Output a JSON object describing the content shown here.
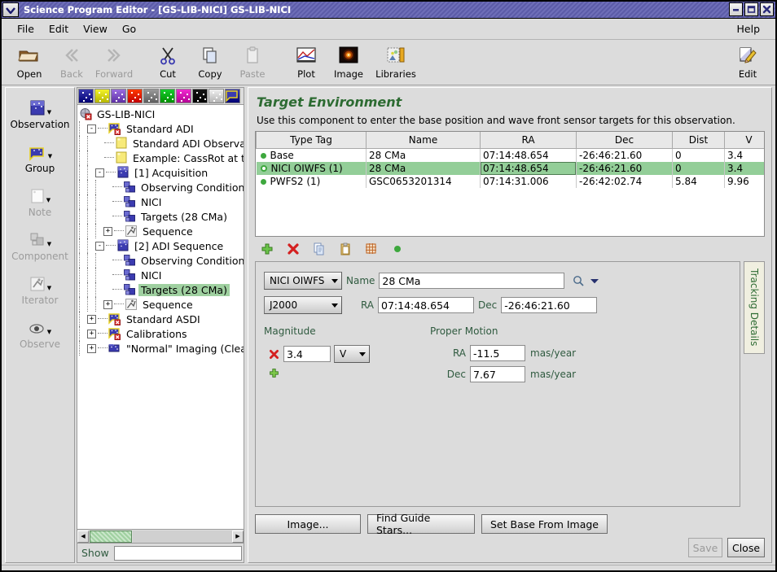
{
  "window": {
    "title": "Science Program Editor - [GS-LIB-NICI] GS-LIB-NICI",
    "minimize_label": "minimize",
    "maximize_label": "maximize",
    "close_label": "close"
  },
  "menubar": {
    "items": [
      "File",
      "Edit",
      "View",
      "Go"
    ],
    "help": "Help"
  },
  "toolbar": {
    "items": [
      {
        "label": "Open",
        "icon": "open-folder-icon",
        "disabled": false
      },
      {
        "label": "Back",
        "icon": "back-arrow-icon",
        "disabled": true
      },
      {
        "label": "Forward",
        "icon": "forward-arrow-icon",
        "disabled": true
      },
      {
        "label": "Cut",
        "icon": "scissors-icon",
        "disabled": false
      },
      {
        "label": "Copy",
        "icon": "copy-icon",
        "disabled": false
      },
      {
        "label": "Paste",
        "icon": "clipboard-icon",
        "disabled": true
      },
      {
        "label": "Plot",
        "icon": "plot-chart-icon",
        "disabled": false
      },
      {
        "label": "Image",
        "icon": "star-image-icon",
        "disabled": false
      },
      {
        "label": "Libraries",
        "icon": "libraries-icon",
        "disabled": false
      }
    ],
    "edit": {
      "label": "Edit",
      "icon": "edit-pencil-icon"
    }
  },
  "palette": {
    "items": [
      {
        "label": "Observation",
        "icon": "observation-icon",
        "disabled": false
      },
      {
        "label": "Group",
        "icon": "group-icon",
        "disabled": false
      },
      {
        "label": "Note",
        "icon": "note-icon",
        "disabled": true
      },
      {
        "label": "Component",
        "icon": "component-icon",
        "disabled": true
      },
      {
        "label": "Iterator",
        "icon": "iterator-icon",
        "disabled": true
      },
      {
        "label": "Observe",
        "icon": "observe-eye-icon",
        "disabled": true
      }
    ]
  },
  "swatches": [
    {
      "name": "swatch-blue",
      "color": "#3b3bb0"
    },
    {
      "name": "swatch-yellow",
      "color": "#f2f22a"
    },
    {
      "name": "swatch-violet",
      "color": "#9a6ce0"
    },
    {
      "name": "swatch-orange",
      "color": "#ff3b00"
    },
    {
      "name": "swatch-gray",
      "color": "#9a9a9a"
    },
    {
      "name": "swatch-green",
      "color": "#17cc2e"
    },
    {
      "name": "swatch-magenta",
      "color": "#f02ad0"
    },
    {
      "name": "swatch-black",
      "color": "#141414"
    },
    {
      "name": "swatch-white",
      "color": "#f0f0f0"
    },
    {
      "name": "swatch-group",
      "color": "#3b3bb0"
    }
  ],
  "tree": {
    "nodes": [
      {
        "label": "GS-LIB-NICI",
        "depth": 0,
        "expander": "",
        "icon": "library-icon",
        "selected": false
      },
      {
        "label": "Standard ADI",
        "depth": 1,
        "expander": "-",
        "icon": "group-icon",
        "selected": false
      },
      {
        "label": "Standard ADI Observati",
        "depth": 2,
        "expander": "",
        "icon": "note-icon",
        "selected": false
      },
      {
        "label": "Example: CassRot at th",
        "depth": 2,
        "expander": "",
        "icon": "note-icon",
        "selected": false
      },
      {
        "label": "[1] Acquisition",
        "depth": 2,
        "expander": "-",
        "icon": "observation-icon",
        "selected": false
      },
      {
        "label": "Observing Condition",
        "depth": 3,
        "expander": "",
        "icon": "component-icon",
        "selected": false
      },
      {
        "label": "NICI",
        "depth": 3,
        "expander": "",
        "icon": "component-icon",
        "selected": false
      },
      {
        "label": "Targets (28 CMa)",
        "depth": 3,
        "expander": "",
        "icon": "component-icon",
        "selected": false
      },
      {
        "label": "Sequence",
        "depth": 3,
        "expander": "+",
        "icon": "iterator-icon",
        "selected": false
      },
      {
        "label": "[2] ADI Sequence",
        "depth": 2,
        "expander": "-",
        "icon": "observation-icon",
        "selected": false
      },
      {
        "label": "Observing Condition",
        "depth": 3,
        "expander": "",
        "icon": "component-icon",
        "selected": false
      },
      {
        "label": "NICI",
        "depth": 3,
        "expander": "",
        "icon": "component-icon",
        "selected": false
      },
      {
        "label": "Targets (28 CMa)",
        "depth": 3,
        "expander": "",
        "icon": "component-icon",
        "selected": true
      },
      {
        "label": "Sequence",
        "depth": 3,
        "expander": "+",
        "icon": "iterator-icon",
        "selected": false
      },
      {
        "label": "Standard ASDI",
        "depth": 1,
        "expander": "+",
        "icon": "group-icon",
        "selected": false
      },
      {
        "label": "Calibrations",
        "depth": 1,
        "expander": "+",
        "icon": "group-icon",
        "selected": false
      },
      {
        "label": "\"Normal\" Imaging (Clear Ma",
        "depth": 1,
        "expander": "+",
        "icon": "folder-icon",
        "selected": false
      }
    ],
    "show_label": "Show",
    "show_value": "",
    "scroll_left_icon": "scroll-left-arrow-icon",
    "scroll_right_icon": "scroll-right-arrow-icon"
  },
  "main": {
    "title": "Target Environment",
    "description": "Use this component to enter the base position and wave front sensor targets for this observation.",
    "table": {
      "columns": [
        "Type Tag",
        "Name",
        "RA",
        "Dec",
        "Dist",
        "V"
      ],
      "rows": [
        {
          "type_tag": "Base",
          "name": "28 CMa",
          "ra": "07:14:48.654",
          "dec": "-26:46:21.60",
          "dist": "0",
          "v": "3.4",
          "dot": "filled",
          "highlighted": false
        },
        {
          "type_tag": "NICI OIWFS (1)",
          "name": "28 CMa",
          "ra": "07:14:48.654",
          "dec": "-26:46:21.60",
          "dist": "0",
          "v": "3.4",
          "dot": "open",
          "highlighted": true
        },
        {
          "type_tag": "PWFS2 (1)",
          "name": "GSC0653201314",
          "ra": "07:14:31.006",
          "dec": "-26:42:02.74",
          "dist": "5.84",
          "v": "9.96",
          "dot": "filled",
          "highlighted": false
        }
      ]
    },
    "table_toolbar": [
      {
        "name": "add-target-button",
        "icon": "green-plus-icon"
      },
      {
        "name": "remove-target-button",
        "icon": "red-x-icon"
      },
      {
        "name": "copy-target-button",
        "icon": "copy-document-icon"
      },
      {
        "name": "paste-target-button",
        "icon": "clipboard-paste-icon"
      },
      {
        "name": "grid-target-button",
        "icon": "orange-grid-icon"
      },
      {
        "name": "primary-target-button",
        "icon": "green-dot-icon"
      }
    ],
    "form": {
      "target_type": "NICI OIWFS",
      "name_label": "Name",
      "name_value": "28 CMa",
      "search_icon": "magnifier-icon",
      "search_dropdown_icon": "chevron-down-icon",
      "epoch": "J2000",
      "ra_label": "RA",
      "ra_value": "07:14:48.654",
      "dec_label": "Dec",
      "dec_value": "-26:46:21.60",
      "magnitude_label": "Magnitude",
      "magnitude_value": "3.4",
      "magnitude_band": "V",
      "magnitude_remove_icon": "red-x-icon",
      "magnitude_add_icon": "green-plus-icon",
      "proper_motion_label": "Proper Motion",
      "pm_ra_label": "RA",
      "pm_ra_value": "-11.5",
      "pm_ra_unit": "mas/year",
      "pm_dec_label": "Dec",
      "pm_dec_value": "7.67",
      "pm_dec_unit": "mas/year"
    },
    "tracking_tab": "Tracking Details",
    "buttons": {
      "image": "Image...",
      "find_guide_stars": "Find Guide Stars...",
      "set_base_from_image": "Set Base From Image",
      "save": "Save",
      "close": "Close"
    }
  }
}
